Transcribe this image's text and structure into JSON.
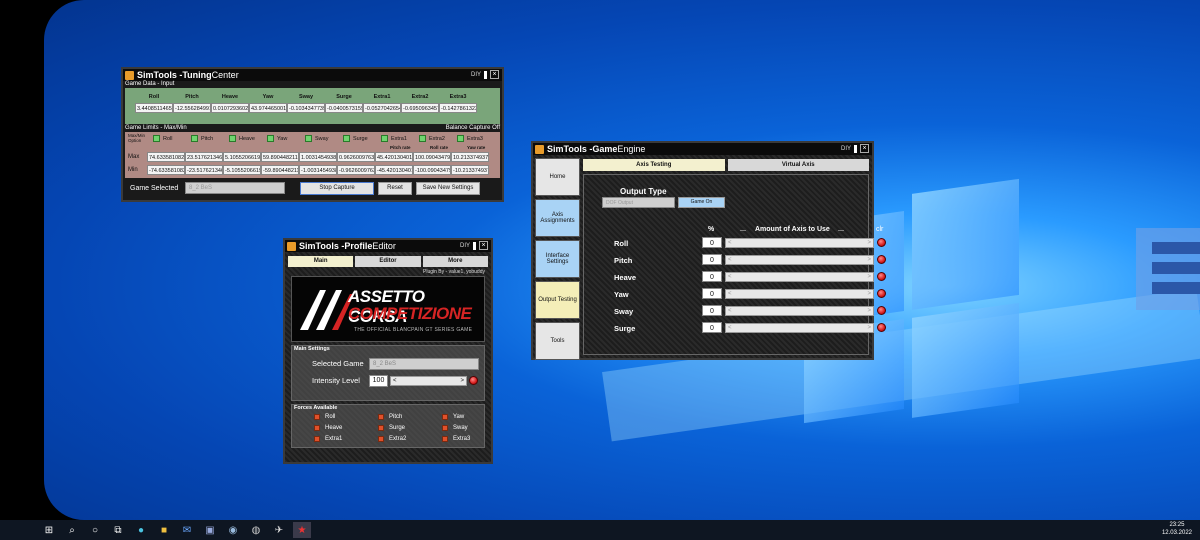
{
  "taskbar": {
    "time": "23:25",
    "date": "12.03.2022"
  },
  "tuning": {
    "title_bold": "SimTools - ",
    "title_rest": "Tuning",
    "title_tail": " Center",
    "diy": "DIY",
    "game_data_label": "Game Data - Input",
    "columns": [
      "Roll",
      "Pitch",
      "Heave",
      "Yaw",
      "Sway",
      "Surge",
      "Extra1",
      "Extra2",
      "Extra3"
    ],
    "inputs": [
      "3.44085114652",
      "-12.5562849911",
      "0.01072936028",
      "43.9744650014",
      "-0.1034347739",
      "-0.0400573159",
      "-0.0527042654",
      "-0.6950963457",
      "-0.1427861323"
    ],
    "limits_label": "Game Limits - Max/Min",
    "balance_label": "Balance Capture Off",
    "maxmin_option": "Max/Min Option",
    "rate_labels": [
      "Pitch rate",
      "Roll rate",
      "Yaw rate"
    ],
    "max_label": "Max",
    "min_label": "Min",
    "max_values": [
      "74.633581082",
      "23.517621346",
      "5.1055206619",
      "59.890448211",
      "1.0031454938",
      "0.9626009763",
      "45.4201304011",
      "100.09043479",
      "10.213374937"
    ],
    "min_values": [
      "-74.633581082",
      "-23.517621346",
      "-5.1055206619",
      "-59.890448211",
      "-1.0031454938",
      "-0.9626009763",
      "-45.4201304011",
      "-100.09043479",
      "-10.213374937"
    ],
    "game_selected_label": "Game Selected",
    "game_selected_value": "8_2 BeS",
    "stop_capture": "Stop Capture",
    "reset": "Reset",
    "save_settings": "Save New Settings"
  },
  "profile": {
    "title_bold": "SimTools - ",
    "title_rest": "Profile",
    "title_tail": " Editor",
    "diy": "DIY",
    "tabs": [
      "Main",
      "Editor",
      "More"
    ],
    "plugin_by": "Plugin By - value1, yobuddy",
    "banner_line1": "ASSETTO CORSA",
    "banner_line2": "COMPETIZIONE",
    "banner_sub": "THE OFFICIAL BLANCPAIN GT SERIES GAME",
    "main_settings": "Main Settings",
    "selected_game_label": "Selected Game",
    "selected_game_value": "8_2 BeS",
    "intensity_label": "Intensity Level",
    "intensity_value": "100",
    "forces_label": "Forces Available",
    "forces": [
      "Roll",
      "Pitch",
      "Yaw",
      "Heave",
      "Surge",
      "Sway",
      "Extra1",
      "Extra2",
      "Extra3"
    ]
  },
  "engine": {
    "title_bold": "SimTools - ",
    "title_rest": "Game",
    "title_tail": " Engine",
    "diy": "DIY",
    "sidebar": [
      "Home",
      "Axis Assignments",
      "Interface Settings",
      "Output Testing",
      "Tools"
    ],
    "tabs": [
      "Axis Testing",
      "Virtual Axis"
    ],
    "output_type_label": "Output Type",
    "output_select": "DOF Output",
    "game_on": "Game On",
    "pct_header": "%",
    "amount_header": "Amount of Axis to Use",
    "dash": "---",
    "clr_header": "clr",
    "axes": [
      {
        "name": "Roll",
        "value": "0"
      },
      {
        "name": "Pitch",
        "value": "0"
      },
      {
        "name": "Heave",
        "value": "0"
      },
      {
        "name": "Yaw",
        "value": "0"
      },
      {
        "name": "Sway",
        "value": "0"
      },
      {
        "name": "Surge",
        "value": "0"
      }
    ],
    "slider_left": "<",
    "slider_right": ">"
  }
}
